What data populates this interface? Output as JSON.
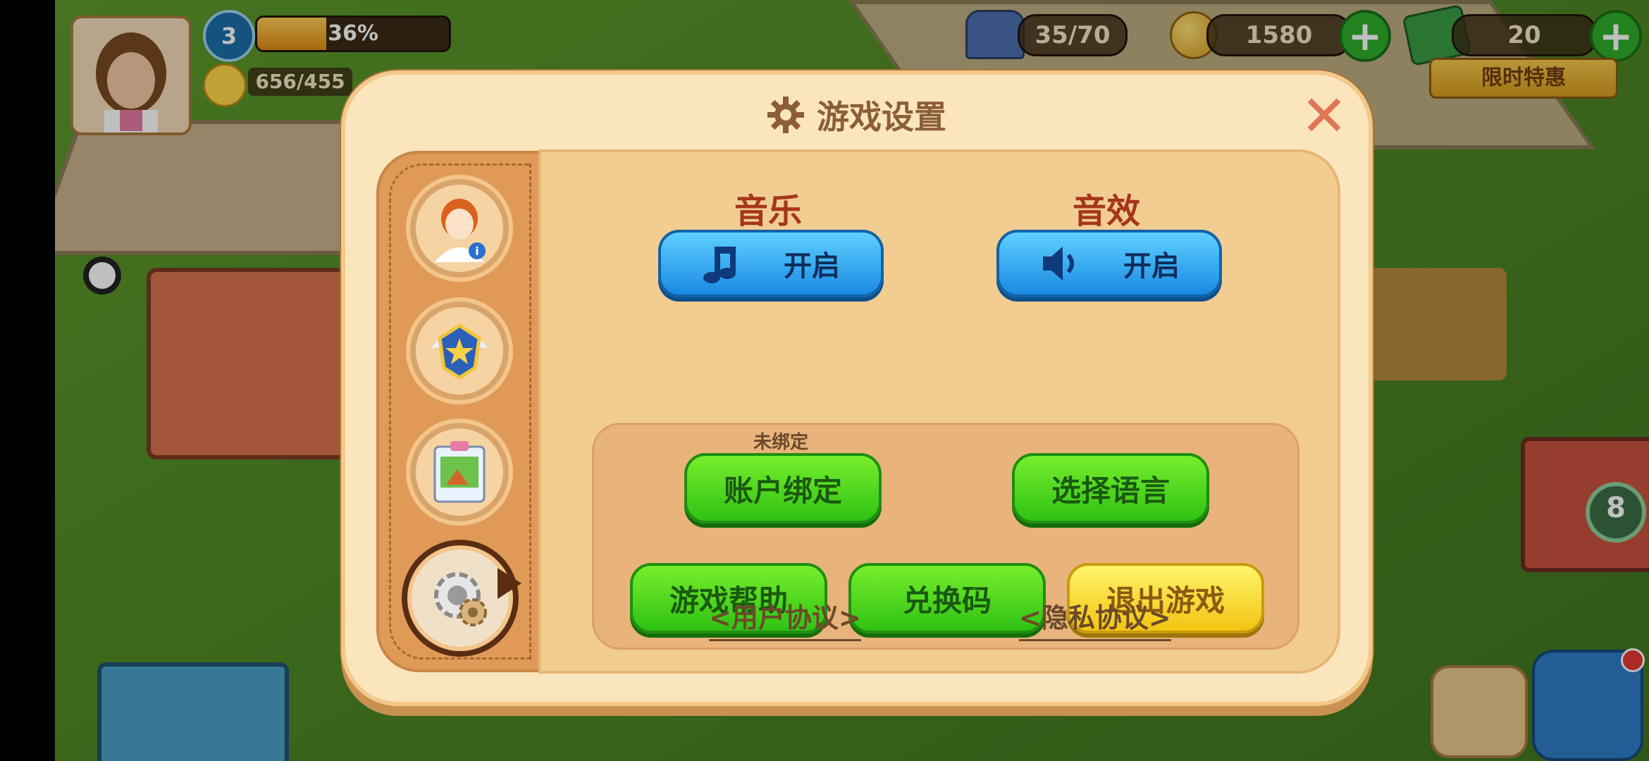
{
  "hud": {
    "level": "3",
    "xp_progress_label": "36%",
    "xp_progress_value": 0.36,
    "happiness": "656/455",
    "population": "35/70",
    "coins": "1580",
    "cash": "20",
    "limited_offer": "限时特惠"
  },
  "dialog": {
    "title": "游戏设置",
    "music_label": "音乐",
    "music_state": "开启",
    "sfx_label": "音效",
    "sfx_state": "开启",
    "unbound_note": "未绑定",
    "account_bind": "账户绑定",
    "select_language": "选择语言",
    "game_help": "游戏帮助",
    "redeem_code": "兑换码",
    "exit_game": "退出游戏",
    "user_agreement": "<用户协议>",
    "privacy_agreement": "<隐私协议>"
  },
  "side_tabs": [
    {
      "icon": "profile-icon",
      "active": false
    },
    {
      "icon": "badge-icon",
      "active": false
    },
    {
      "icon": "album-icon",
      "active": false
    },
    {
      "icon": "settings-gear-icon",
      "active": true
    }
  ],
  "colors": {
    "accent_blue": "#1a8ae3",
    "accent_green": "#2fc214",
    "accent_yellow": "#f1c512",
    "title_brown": "#8b5e37"
  }
}
